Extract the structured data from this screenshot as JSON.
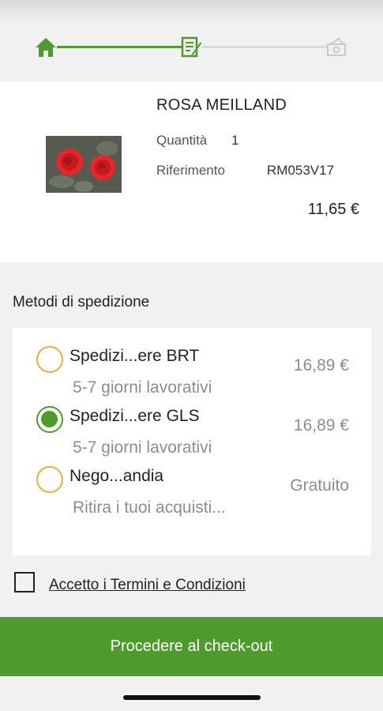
{
  "stepper": {
    "steps": [
      {
        "icon": "home-icon",
        "state": "done"
      },
      {
        "icon": "form-edit-icon",
        "state": "current"
      },
      {
        "icon": "payment-icon",
        "state": "todo"
      }
    ],
    "accent_color": "#4e9a2c"
  },
  "product": {
    "name": "ROSA MEILLAND",
    "quantity_label": "Quantità",
    "quantity_value": "1",
    "reference_label": "Riferimento",
    "reference_value": "RM053V17",
    "price": "11,65 €",
    "image": "red-roses-photo"
  },
  "shipping": {
    "title": "Metodi di spedizione",
    "options": [
      {
        "name": "Spedizi...ere BRT",
        "subtitle": "5-7 giorni lavorativi",
        "price": "16,89 €",
        "selected": false
      },
      {
        "name": "Spedizi...ere GLS",
        "subtitle": "5-7 giorni lavorativi",
        "price": "16,89 €",
        "selected": true
      },
      {
        "name": "Nego...andia",
        "subtitle": "Ritira i tuoi acquisti...",
        "price": "Gratuito",
        "selected": false
      }
    ],
    "selected_color": "#4e9a2c",
    "unselected_color": "#e7ad3a"
  },
  "terms": {
    "label": "Accetto i Termini e Condizioni",
    "checked": false
  },
  "checkout": {
    "label": "Procedere al check-out"
  }
}
